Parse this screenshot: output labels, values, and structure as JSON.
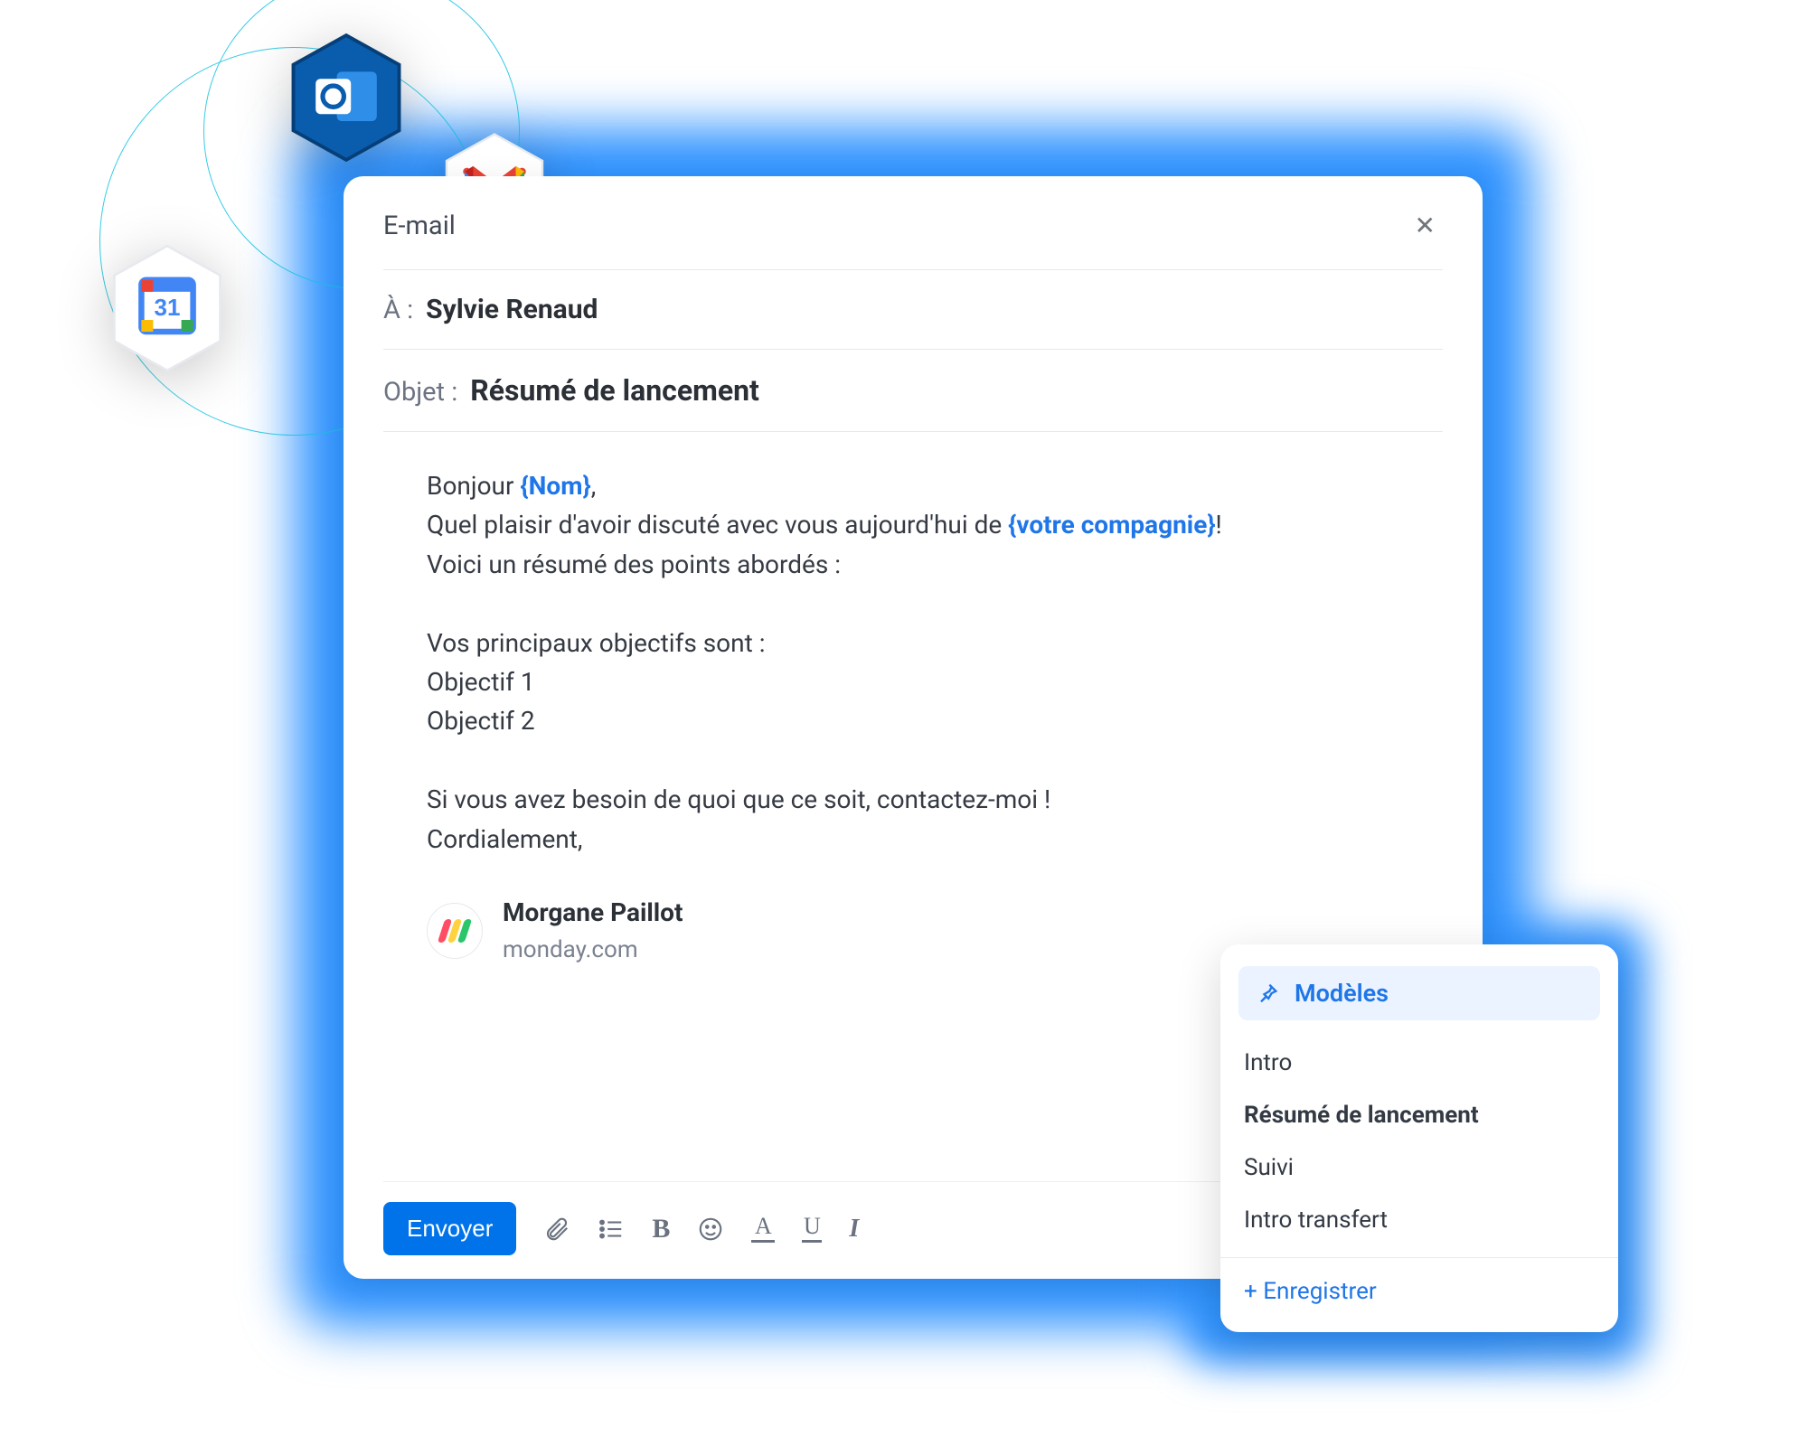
{
  "compose": {
    "title": "E-mail",
    "to_label": "À :",
    "to_value": "Sylvie Renaud",
    "subject_label": "Objet :",
    "subject_value": "Résumé de lancement",
    "body": {
      "greeting_pre": "Bonjour ",
      "greeting_ph": "{Nom}",
      "greeting_post": ",",
      "line2_pre": "Quel plaisir d'avoir discuté avec vous aujourd'hui de ",
      "line2_ph": "{votre compagnie}",
      "line2_post": "!",
      "line3": "Voici un résumé des points abordés :",
      "goals_intro": "Vos principaux objectifs sont :",
      "goal1": "Objectif 1",
      "goal2": "Objectif 2",
      "closing1": "Si vous avez besoin de quoi que ce soit, contactez-moi !",
      "closing2": "Cordialement,"
    },
    "signature": {
      "name": "Morgane Paillot",
      "company": "monday.com"
    },
    "send_label": "Envoyer"
  },
  "templates": {
    "header": "Modèles",
    "items": [
      {
        "label": "Intro",
        "active": false
      },
      {
        "label": "Résumé de lancement",
        "active": true
      },
      {
        "label": "Suivi",
        "active": false
      },
      {
        "label": "Intro transfert",
        "active": false
      }
    ],
    "save_label": "+ Enregistrer"
  },
  "decorative_icons": [
    "outlook-icon",
    "gmail-icon",
    "google-calendar-icon"
  ]
}
